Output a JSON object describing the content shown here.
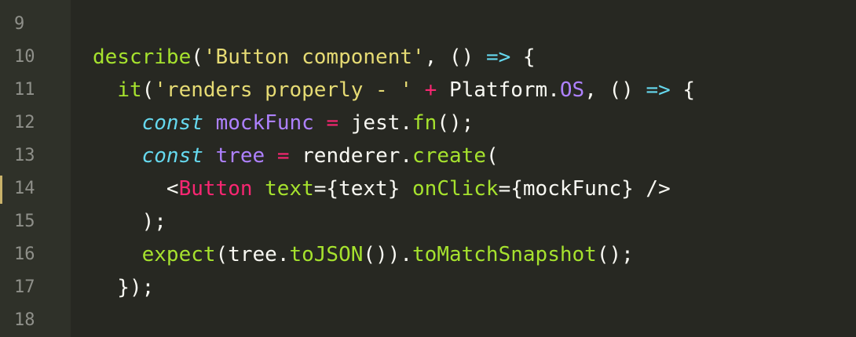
{
  "editor": {
    "top_fragment": "'",
    "line_numbers": [
      "9",
      "10",
      "11",
      "12",
      "13",
      "14",
      "15",
      "16",
      "17",
      "18"
    ],
    "lines": [
      [],
      [
        {
          "t": "describe",
          "c": "func"
        },
        {
          "t": "(",
          "c": "plain"
        },
        {
          "t": "'Button component'",
          "c": "str"
        },
        {
          "t": ", () ",
          "c": "plain"
        },
        {
          "t": "=>",
          "c": "arrow"
        },
        {
          "t": " {",
          "c": "plain"
        }
      ],
      [
        {
          "t": "  ",
          "c": "plain"
        },
        {
          "t": "it",
          "c": "func"
        },
        {
          "t": "(",
          "c": "plain"
        },
        {
          "t": "'renders properly - '",
          "c": "str"
        },
        {
          "t": " ",
          "c": "plain"
        },
        {
          "t": "+",
          "c": "op"
        },
        {
          "t": " Platform.",
          "c": "plain"
        },
        {
          "t": "OS",
          "c": "const"
        },
        {
          "t": ", () ",
          "c": "plain"
        },
        {
          "t": "=>",
          "c": "arrow"
        },
        {
          "t": " {",
          "c": "plain"
        }
      ],
      [
        {
          "t": "    ",
          "c": "plain"
        },
        {
          "t": "const",
          "c": "kw"
        },
        {
          "t": " ",
          "c": "plain"
        },
        {
          "t": "mockFunc",
          "c": "var"
        },
        {
          "t": " ",
          "c": "plain"
        },
        {
          "t": "=",
          "c": "op"
        },
        {
          "t": " jest.",
          "c": "plain"
        },
        {
          "t": "fn",
          "c": "func"
        },
        {
          "t": "();",
          "c": "plain"
        }
      ],
      [
        {
          "t": "    ",
          "c": "plain"
        },
        {
          "t": "const",
          "c": "kw"
        },
        {
          "t": " ",
          "c": "plain"
        },
        {
          "t": "tree",
          "c": "var"
        },
        {
          "t": " ",
          "c": "plain"
        },
        {
          "t": "=",
          "c": "op"
        },
        {
          "t": " renderer.",
          "c": "plain"
        },
        {
          "t": "create",
          "c": "func"
        },
        {
          "t": "(",
          "c": "plain"
        }
      ],
      [
        {
          "t": "      <",
          "c": "plain"
        },
        {
          "t": "Button",
          "c": "tag"
        },
        {
          "t": " ",
          "c": "plain"
        },
        {
          "t": "text",
          "c": "attr"
        },
        {
          "t": "={text} ",
          "c": "plain"
        },
        {
          "t": "onClick",
          "c": "attr"
        },
        {
          "t": "={mockFunc} />",
          "c": "plain"
        }
      ],
      [
        {
          "t": "    );",
          "c": "plain"
        }
      ],
      [
        {
          "t": "    ",
          "c": "plain"
        },
        {
          "t": "expect",
          "c": "func"
        },
        {
          "t": "(tree.",
          "c": "plain"
        },
        {
          "t": "toJSON",
          "c": "func"
        },
        {
          "t": "()).",
          "c": "plain"
        },
        {
          "t": "toMatchSnapshot",
          "c": "func"
        },
        {
          "t": "();",
          "c": "plain"
        }
      ],
      [
        {
          "t": "  });",
          "c": "plain"
        }
      ],
      []
    ]
  }
}
